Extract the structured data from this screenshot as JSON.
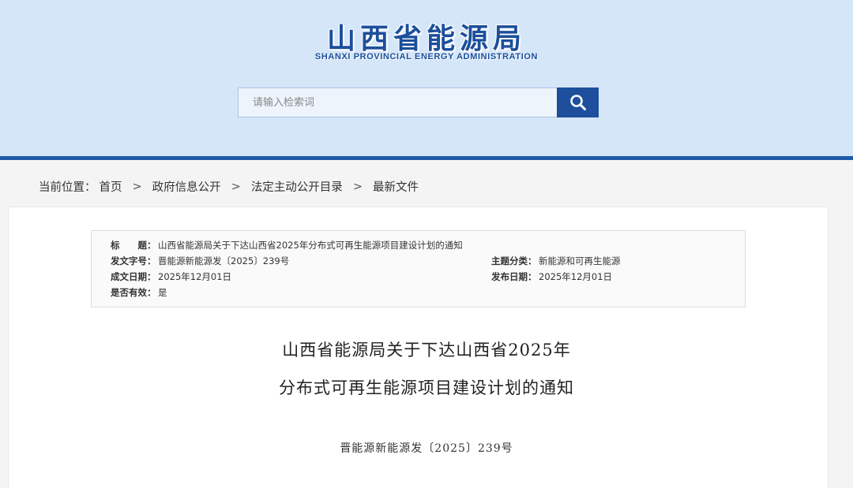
{
  "header": {
    "title_cn": "山西省能源局",
    "title_en": "SHANXI PROVINCIAL ENERGY ADMINISTRATION",
    "search_placeholder": "请输入检索词",
    "search_icon": "search-icon",
    "colors": {
      "header_bg": "#d5e6f9",
      "brand_blue": "#1d4f9c",
      "bar": "#1d5aa8"
    }
  },
  "breadcrumb": {
    "label": "当前位置：",
    "items": [
      "首页",
      "政府信息公开",
      "法定主动公开目录",
      "最新文件"
    ],
    "separator": ">"
  },
  "meta": {
    "title_key": "标　　题：",
    "title_value": "山西省能源局关于下达山西省2025年分布式可再生能源项目建设计划的通知",
    "docno_key": "发文字号：",
    "docno_value": "晋能源新能源发〔2025〕239号",
    "category_key": "主题分类：",
    "category_value": "新能源和可再生能源",
    "created_key": "成文日期：",
    "created_value": "2025年12月01日",
    "published_key": "发布日期：",
    "published_value": "2025年12月01日",
    "valid_key": "是否有效：",
    "valid_value": "是"
  },
  "article": {
    "title_line1": "山西省能源局关于下达山西省2025年",
    "title_line2": "分布式可再生能源项目建设计划的通知",
    "doc_number": "晋能源新能源发〔2025〕239号"
  }
}
